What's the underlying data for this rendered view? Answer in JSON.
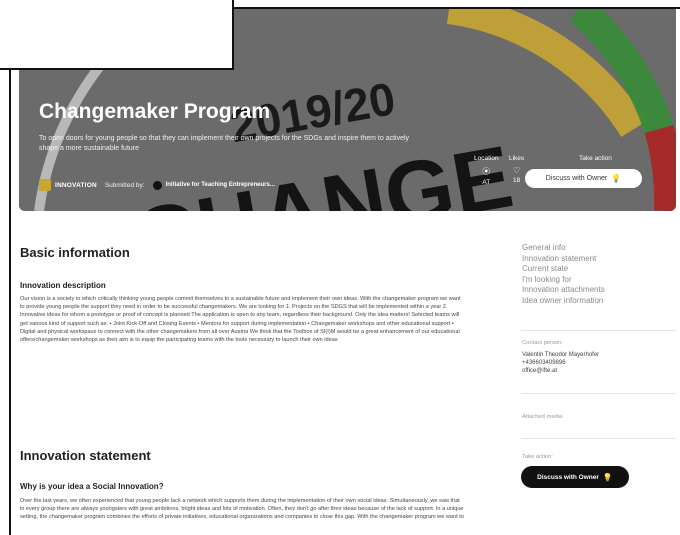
{
  "hero": {
    "banner_year": "2019/20",
    "banner_word": "CHANGE",
    "title": "Changemaker Program",
    "description": "To open doors for young people so that they can implement their own projects for the SDGs and inspire them to actively shape a more sustainable future",
    "tag": "INNOVATION",
    "submitted_by_label": "Submitted by:",
    "submitter": "Initiative for Teaching Entrepreneurs...",
    "location_label": "Location",
    "location_value": "AT",
    "likes_label": "Likes",
    "likes_value": "18",
    "take_action_label": "Take action",
    "discuss_button": "Discuss with Owner"
  },
  "main": {
    "basic_heading": "Basic information",
    "innovation_desc_heading": "Innovation description",
    "innovation_desc_text": "Our vision is a society in which critically thinking young people commit themselves to a sustainable future and implement their own ideas. With the changemaker program we want to provide young people the support they need in order to be successful changemakers. We are looking for 1. Projects on the SDGS that will be implemented within a year 2. Innovative ideas for whom a prototype or proof of concept is planned The application is open to any team, regardless their background. Only the idea matters! Selected teams will get various kind of support such as: • Joint Kick-Off and Closing Events • Mentors for support during implementation • Changemaker workshops and other educational support • Digital and physical workspace to connect with the other changemakers from all over Austria We think that the Toolbox of SI(I)M would be a great enhancement of our educational offers/changemaker workshops as their aim is to equip the participating teams with the tools necessary to launch their own ideas",
    "statement_heading": "Innovation statement",
    "social_question": "Why is your idea a Social Innovation?",
    "social_text": "Over the last years, we often experienced that young people lack a network which supports them during the implementation of their own social ideas. Simultaneously, we saw that in every group there are always youngsters with great ambitions, bright ideas and lots of motivation. Often, they don't go after their ideas because of the lack of support. In a unique setting, the changemaker program combines the efforts of private initiatives, educational organizations and companies to close this gap. With the changemaker program we want to"
  },
  "sidebar": {
    "toc": [
      "General info",
      "Innovation statement",
      "Current state",
      "I'm looking for",
      "Innovation attachments",
      "Idea owner information"
    ],
    "contact_label": "Contact person:",
    "contact_name": "Valentin Theodor Mayerhofer",
    "contact_phone": "+436603409896",
    "contact_email": "office@ifte.at",
    "attached_media_label": "Attached media",
    "take_action_label": "Take action:",
    "discuss_button": "Discuss with Owner"
  },
  "colors": {
    "hero_gray": "#6e6e6e",
    "ring_yellow": "#c9a532",
    "ring_green": "#3a8a3a",
    "ring_red": "#a52a2a",
    "accent_bulb": "#e0b020"
  }
}
